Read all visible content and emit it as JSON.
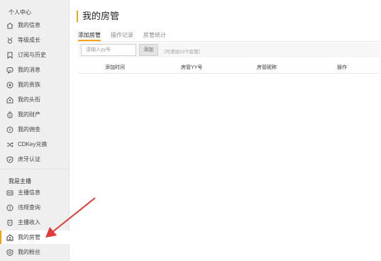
{
  "sidebar": {
    "personal_title": "个人中心",
    "personal_items": [
      {
        "label": "我的信息",
        "icon": "home-icon"
      },
      {
        "label": "等级成长",
        "icon": "medal-icon"
      },
      {
        "label": "订阅与历史",
        "icon": "bookmark-icon"
      },
      {
        "label": "我的消息",
        "icon": "message-icon"
      },
      {
        "label": "我的贵族",
        "icon": "noble-icon"
      },
      {
        "label": "我的头衔",
        "icon": "title-icon"
      },
      {
        "label": "我的财产",
        "icon": "wallet-icon"
      },
      {
        "label": "我的佣金",
        "icon": "coin-icon"
      },
      {
        "label": "CDKey兑换",
        "icon": "shuffle-icon"
      },
      {
        "label": "虎牙认证",
        "icon": "verified-shield-icon"
      }
    ],
    "anchor_title": "我是主播",
    "anchor_items": [
      {
        "label": "主播信息",
        "icon": "id-card-icon"
      },
      {
        "label": "违规查询",
        "icon": "warning-icon"
      },
      {
        "label": "主播收入",
        "icon": "income-icon"
      },
      {
        "label": "我的房管",
        "icon": "house-user-icon"
      },
      {
        "label": "我的粉丝",
        "icon": "fans-shield-icon"
      }
    ]
  },
  "main": {
    "title": "我的房管",
    "tabs": [
      {
        "label": "添加房管",
        "active": true
      },
      {
        "label": "操作记录",
        "active": false
      },
      {
        "label": "房管统计",
        "active": false
      }
    ],
    "input_placeholder": "请输入yy号",
    "add_button": "添加",
    "hint": "（可添加10个房管）",
    "table_headers": [
      "添加时间",
      "房管YY号",
      "房管昵称",
      "操作"
    ]
  },
  "colors": {
    "accent": "#f7a51c",
    "arrow": "#e03a3a",
    "sidebar_bg": "#efefef"
  }
}
